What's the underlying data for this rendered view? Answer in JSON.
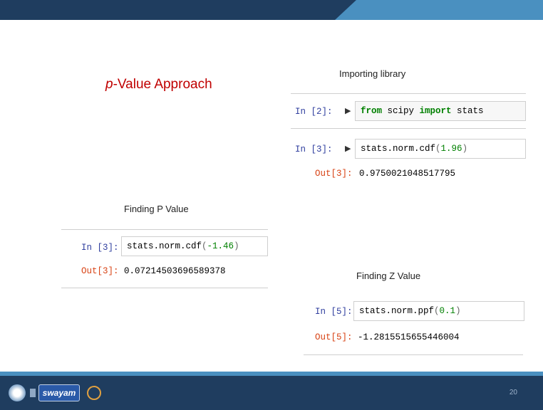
{
  "slide": {
    "title_italic": "p",
    "title_rest": "-Value Approach",
    "page_number": "20"
  },
  "importing": {
    "heading": "Importing library",
    "cell1": {
      "prompt": "In [2]:",
      "code": {
        "kw1": "from",
        "mod": " scipy ",
        "kw2": "import",
        "rest": " stats"
      }
    },
    "cell2": {
      "prompt": "In [3]:",
      "code": {
        "fn": "stats.norm.cdf",
        "open": "(",
        "num": "1.96",
        "close": ")"
      },
      "out_prompt": "Out[3]:",
      "output": "0.9750021048517795"
    }
  },
  "finding_p": {
    "heading": "Finding P Value",
    "prompt": "In [3]:",
    "code": {
      "fn": "stats.norm.cdf",
      "open": "(",
      "num": "-1.46",
      "close": ")"
    },
    "out_prompt": "Out[3]:",
    "output": "0.07214503696589378"
  },
  "finding_z": {
    "heading": "Finding Z Value",
    "prompt": "In [5]:",
    "code": {
      "fn": "stats.norm.ppf",
      "open": "(",
      "num": "0.1",
      "close": ")"
    },
    "out_prompt": "Out[5]:",
    "output": "-1.2815515655446004"
  },
  "footer": {
    "logo_text": "swayam"
  },
  "colors": {
    "title": "#c00000",
    "in_prompt": "#303f9f",
    "out_prompt": "#d84315",
    "keyword": "#008000",
    "footer_bg": "#1f3d5f"
  }
}
